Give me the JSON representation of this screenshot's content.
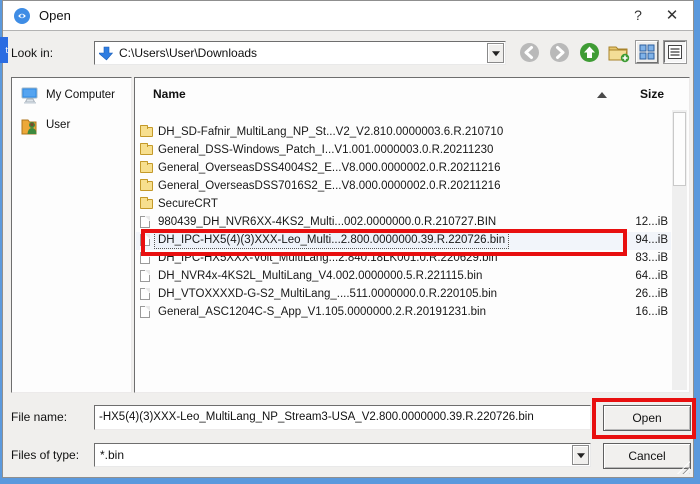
{
  "window": {
    "title": "Open",
    "help_button": "?",
    "close_button": "✕"
  },
  "toolbar": {
    "look_in_label": "Look in:",
    "path_value": "C:\\Users\\User\\Downloads",
    "icons": [
      "path-down-arrow-icon",
      "back-icon",
      "forward-icon",
      "up-icon",
      "new-folder-icon",
      "icon-view-icon",
      "detail-view-icon"
    ]
  },
  "sidebar": {
    "items": [
      {
        "label": "My Computer",
        "icon": "computer-icon"
      },
      {
        "label": "User",
        "icon": "user-folder-icon"
      }
    ]
  },
  "file_list": {
    "columns": {
      "name": "Name",
      "size": "Size"
    },
    "sort_indicator": "ascending-triangle-icon",
    "rows": [
      {
        "name": "DH_SD-Fafnir_MultiLang_NP_St...V2_V2.810.0000003.6.R.210710",
        "type": "folder",
        "size": ""
      },
      {
        "name": "General_DSS-Windows_Patch_I...V1.001.0000003.0.R.20211230",
        "type": "folder",
        "size": ""
      },
      {
        "name": "General_OverseasDSS4004S2_E...V8.000.0000002.0.R.20211216",
        "type": "folder",
        "size": ""
      },
      {
        "name": "General_OverseasDSS7016S2_E...V8.000.0000002.0.R.20211216",
        "type": "folder",
        "size": ""
      },
      {
        "name": "SecureCRT",
        "type": "folder",
        "size": ""
      },
      {
        "name": "980439_DH_NVR6XX-4KS2_Multi...002.0000000.0.R.210727.BIN",
        "type": "file",
        "size": "12...iB"
      },
      {
        "name": "DH_IPC-HX5(4)(3)XXX-Leo_Multi...2.800.0000000.39.R.220726.bin",
        "type": "file",
        "size": "94...iB",
        "selected": true
      },
      {
        "name": "DH_IPC-HX5XXX-Volt_MultiLang...2.840.18LK001.0.R.220629.bin",
        "type": "file",
        "size": "83...iB"
      },
      {
        "name": "DH_NVR4x-4KS2L_MultiLang_V4.002.0000000.5.R.221115.bin",
        "type": "file",
        "size": "64...iB"
      },
      {
        "name": "DH_VTOXXXXD-G-S2_MultiLang_....511.0000000.0.R.220105.bin",
        "type": "file",
        "size": "26...iB"
      },
      {
        "name": "General_ASC1204C-S_App_V1.105.0000000.2.R.20191231.bin",
        "type": "file",
        "size": "16...iB"
      }
    ]
  },
  "footer": {
    "file_name_label": "File name:",
    "file_name_value": "-HX5(4)(3)XXX-Leo_MultiLang_NP_Stream3-USA_V2.800.0000000.39.R.220726.bin",
    "files_of_type_label": "Files of type:",
    "files_of_type_value": "*.bin",
    "open_label": "Open",
    "cancel_label": "Cancel"
  },
  "background_window": {
    "tab_fragment": "t"
  },
  "colors": {
    "annotation_red": "#e80f0f",
    "edge_blue": "#5b99dd",
    "tab_blue": "#2a6ce2",
    "selection_bg": "#eef2f9",
    "folder_yellow": "#f7df8e"
  }
}
